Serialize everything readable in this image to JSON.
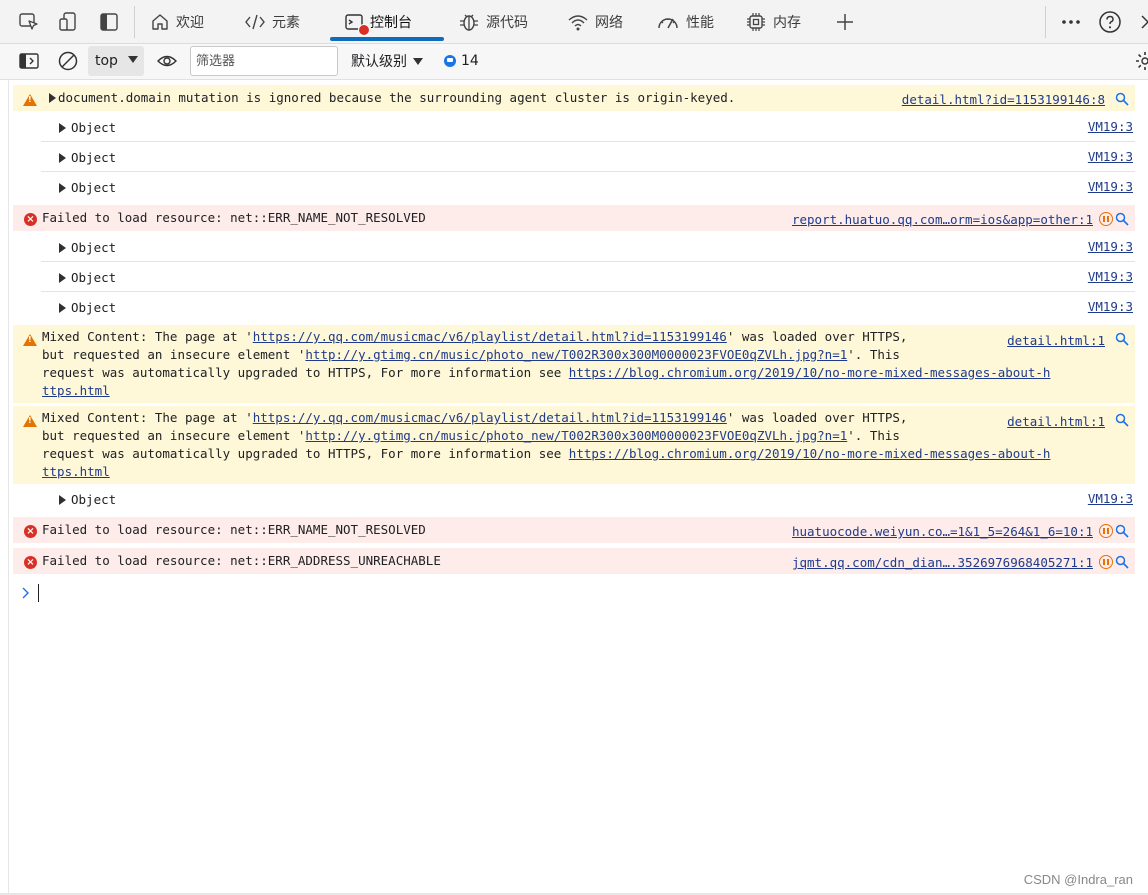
{
  "tabs": [
    {
      "name": "tab-welcome",
      "label": "欢迎",
      "icon": "home-icon"
    },
    {
      "name": "tab-elements",
      "label": "元素",
      "icon": "code-icon"
    },
    {
      "name": "tab-console",
      "label": "控制台",
      "icon": "console-icon",
      "active": true
    },
    {
      "name": "tab-sources",
      "label": "源代码",
      "icon": "bug-icon"
    },
    {
      "name": "tab-network",
      "label": "网络",
      "icon": "wifi-icon"
    },
    {
      "name": "tab-performance",
      "label": "性能",
      "icon": "gauge-icon"
    },
    {
      "name": "tab-memory",
      "label": "内存",
      "icon": "chip-icon"
    }
  ],
  "toolbar": {
    "context": "top",
    "filter_placeholder": "筛选器",
    "levels_label": "默认级别",
    "issues_count": "14"
  },
  "colors": {
    "warning_bg": "#fef7d8",
    "error_bg": "#fdecea",
    "accent": "#0f6cbd",
    "link": "#1f3b8a"
  },
  "messages": {
    "m1": {
      "text": "document.domain mutation is ignored because the surrounding agent cluster is origin-keyed.",
      "source": "detail.html?id=1153199146:8"
    },
    "obj": "Object",
    "vm": "VM19:3",
    "e1": {
      "text": "Failed to load resource: net::ERR_NAME_NOT_RESOLVED",
      "source": "report.huatuo.qq.com…orm=ios&app=other:1"
    },
    "mixed": {
      "p1": "Mixed Content: The page at '",
      "url1": "https://y.qq.com/musicmac/v6/playlist/detail.html?id=1153199146",
      "p2": "' was loaded over HTTPS,",
      "p3": "but requested an insecure element '",
      "url2": "http://y.gtimg.cn/music/photo_new/T002R300x300M0000023FVOE0qZVLh.jpg?n=1",
      "p4": "'. This",
      "p5": "request was automatically upgraded to HTTPS, For more information see ",
      "url3a": "https://blog.chromium.org/2019/10/no-more-mixed-messages-about-h",
      "url3b": "ttps.html",
      "source": "detail.html:1"
    },
    "e2": {
      "text": "Failed to load resource: net::ERR_NAME_NOT_RESOLVED",
      "source": "huatuocode.weiyun.co…=1&1_5=264&1_6=10:1"
    },
    "e3": {
      "text": "Failed to load resource: net::ERR_ADDRESS_UNREACHABLE",
      "source": "jqmt.qq.com/cdn_dian….3526976968405271:1"
    }
  },
  "watermark": "CSDN @Indra_ran"
}
